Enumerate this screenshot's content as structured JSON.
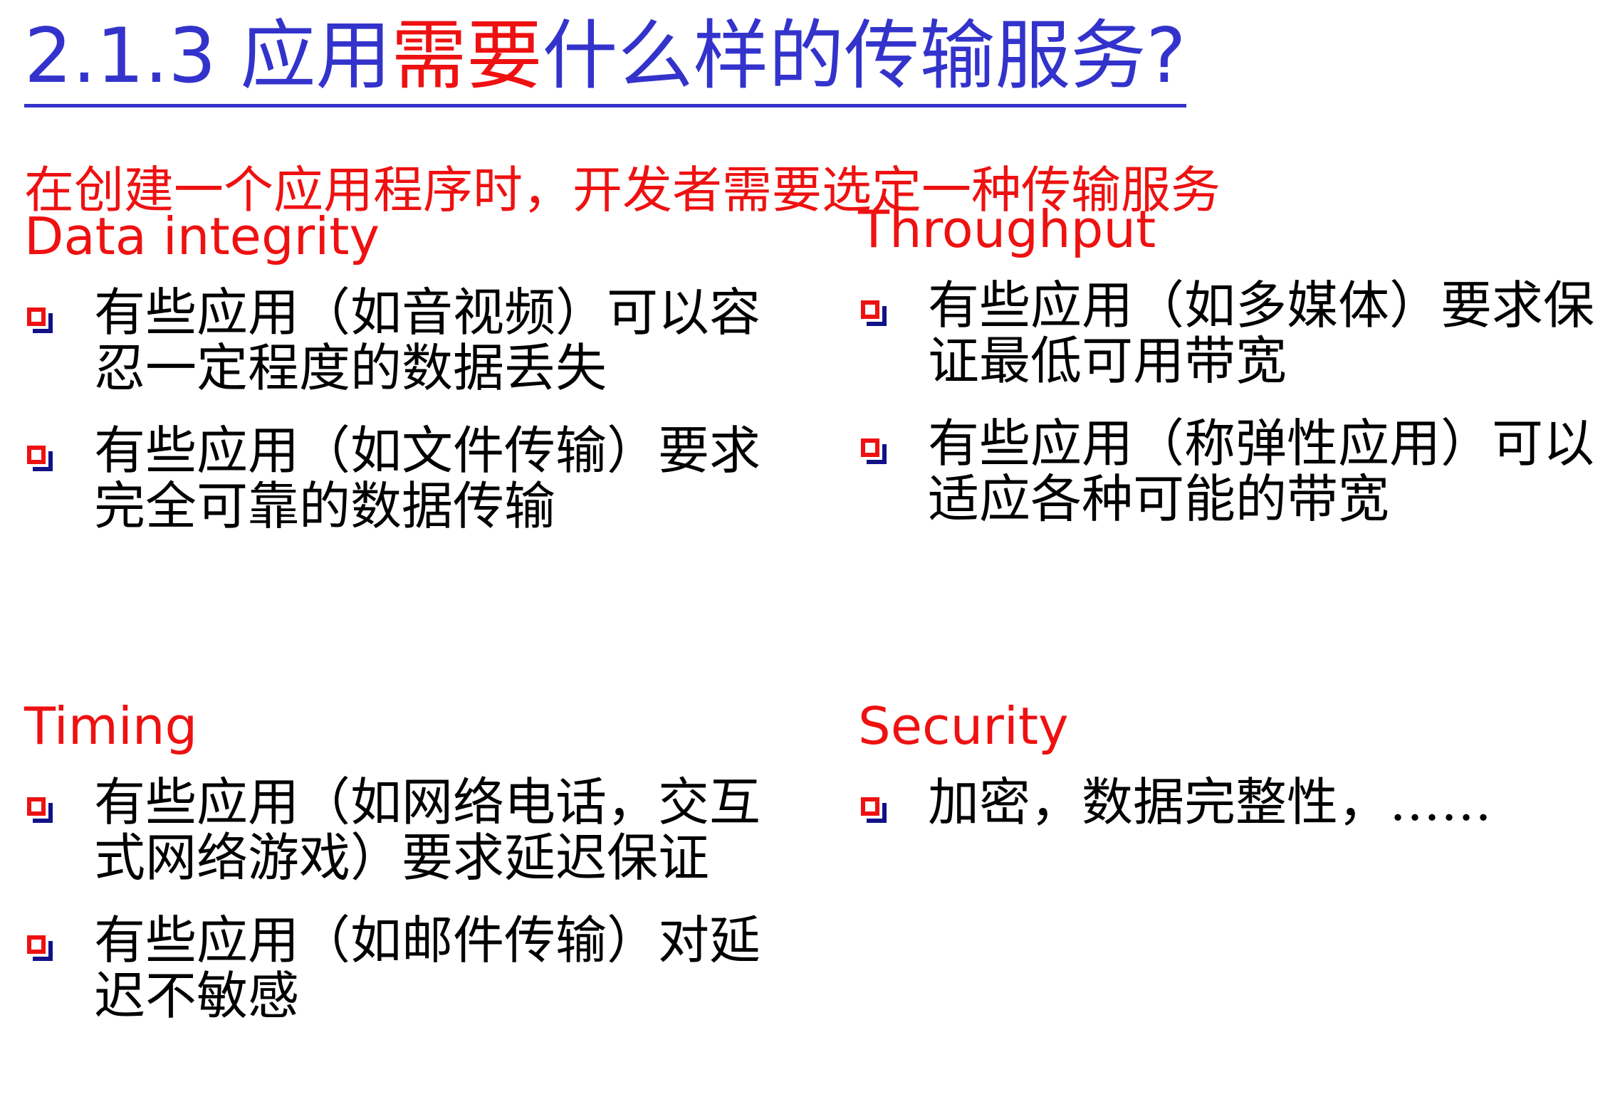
{
  "title": {
    "prefix": "2.1.3 应用",
    "highlight": "需要",
    "suffix": "什么样的传输服务?"
  },
  "subtitle": "在创建一个应用程序时，开发者需要选定一种传输服务",
  "sections": [
    {
      "heading": "Data integrity",
      "items": [
        "有些应用（如音视频）可以容忍一定程度的数据丢失",
        "有些应用（如文件传输）要求完全可靠的数据传输"
      ]
    },
    {
      "heading": "Throughput",
      "items": [
        "有些应用（如多媒体）要求保证最低可用带宽",
        "有些应用（称弹性应用）可以适应各种可能的带宽"
      ]
    },
    {
      "heading": "Timing",
      "items": [
        "有些应用（如网络电话，交互式网络游戏）要求延迟保证",
        "有些应用（如邮件传输）对延迟不敏感"
      ]
    },
    {
      "heading": "Security",
      "items": [
        "加密，数据完整性，……"
      ]
    }
  ],
  "colors": {
    "title": "#3333cc",
    "accent": "#ee1111",
    "body_text": "#000000",
    "bullet_shadow": "#111188"
  },
  "icons": {
    "bullet": "square-bullet-icon"
  }
}
